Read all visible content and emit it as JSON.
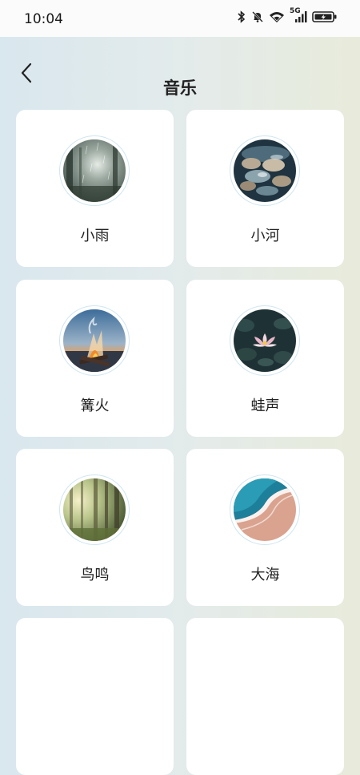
{
  "status_bar": {
    "time": "10:04",
    "network_label": "5G",
    "icons": [
      "bluetooth-icon",
      "bell-muted-icon",
      "wifi-icon",
      "signal-icon",
      "battery-charging-icon"
    ]
  },
  "header": {
    "back_icon": "chevron-left-icon",
    "title": "音乐"
  },
  "sounds": [
    {
      "label": "小雨",
      "image": "rain-forest-image"
    },
    {
      "label": "小河",
      "image": "river-stones-image"
    },
    {
      "label": "篝火",
      "image": "campfire-image"
    },
    {
      "label": "蛙声",
      "image": "lotus-pond-image"
    },
    {
      "label": "鸟鸣",
      "image": "sunlit-forest-image"
    },
    {
      "label": "大海",
      "image": "ocean-shore-image"
    },
    {
      "label": "",
      "image": ""
    },
    {
      "label": "",
      "image": ""
    }
  ]
}
